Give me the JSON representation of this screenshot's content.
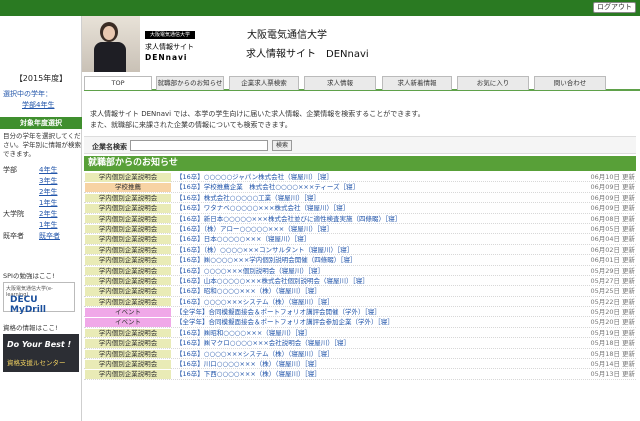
{
  "header": {
    "logout_label": "ログアウト",
    "logo_tag": "大阪電気通信大学",
    "logo_line1": "求人情報サイト",
    "logo_line2": "DENnavi",
    "site_title_line1": "大阪電気通信大学",
    "site_title_line2": "求人情報サイト　DENnavi"
  },
  "nav": {
    "tabs": [
      "TOP",
      "就職部からのお知らせ",
      "企業求人票検索",
      "求人情報",
      "求人新着情報",
      "お気に入り",
      "問い合わせ"
    ]
  },
  "sidebar": {
    "year": "【2015年度】",
    "gakunen_label": "選択中の学年：",
    "gakunen_value": "学部4年生",
    "select_head": "対象年度選択",
    "select_desc": "目分の学年を選択してください。学年別に情報が検索できます。",
    "grades": [
      {
        "cat": "学部",
        "label": "4年生"
      },
      {
        "cat": "",
        "label": "3年生"
      },
      {
        "cat": "",
        "label": "2年生"
      },
      {
        "cat": "",
        "label": "1年生"
      },
      {
        "cat": "大学院",
        "label": "2年生"
      },
      {
        "cat": "",
        "label": "1年生"
      },
      {
        "cat": "既卒者",
        "label": "既卒者"
      }
    ],
    "spi_label": "SPIの勉強はここ!",
    "spi_banner_small": "大阪電気通信大学(e-learning)",
    "spi_banner_big": "DECU MyDrill",
    "shikaku_label": "資格の情報はここ!",
    "shikaku_banner_line1": "Do Your Best !",
    "shikaku_banner_line2": "資格支援ルセンター"
  },
  "main": {
    "intro_line1": "求人情報サイト DENnavi では、本学の学生向けに届いた求人情報、企業情報を検索することができます。",
    "intro_line2": "また、就職部に来課された企業の情報についても検索できます。",
    "search_label": "企業名検索",
    "search_placeholder": "",
    "search_button": "検索",
    "notice_head": "就職部からのお知らせ"
  },
  "notices": [
    {
      "cat": "学内個別企業説明会",
      "type": "normal",
      "title": "【16卒】○○○○○ジャパン株式会社（寝屋川）［寝］",
      "date": "06月10日",
      "upd": "更新"
    },
    {
      "cat": "学校推薦",
      "type": "suisen",
      "title": "【16卒】学校推薦企業　株式会社○○○○×××ティーズ［寝］",
      "date": "06月09日",
      "upd": "更新"
    },
    {
      "cat": "学内個別企業説明会",
      "type": "normal",
      "title": "【16卒】株式会社○○○○○工業（寝屋川）［寝］",
      "date": "06月09日",
      "upd": "更新"
    },
    {
      "cat": "学内個別企業説明会",
      "type": "normal",
      "title": "【16卒】ワタナベ○○○○○×××株式会社（寝屋川）［寝］",
      "date": "06月09日",
      "upd": "更新"
    },
    {
      "cat": "学内個別企業説明会",
      "type": "normal",
      "title": "【16卒】新日本○○○○○×××株式会社並びに適性検査実施（四條畷）［寝］",
      "date": "06月08日",
      "upd": "更新"
    },
    {
      "cat": "学内個別企業説明会",
      "type": "normal",
      "title": "【16卒】（株）アロー○○○○○×××（寝屋川）［寝］",
      "date": "06月05日",
      "upd": "更新"
    },
    {
      "cat": "学内個別企業説明会",
      "type": "normal",
      "title": "【16卒】日本○○○○○×××（寝屋川）［寝］",
      "date": "06月04日",
      "upd": "更新"
    },
    {
      "cat": "学内個別企業説明会",
      "type": "normal",
      "title": "【16卒】（株）○○○○×××コンサルタント（寝屋川）［寝］",
      "date": "06月02日",
      "upd": "更新"
    },
    {
      "cat": "学内個別企業説明会",
      "type": "normal",
      "title": "【16卒】㈱○○○○×××学内個別説明会開催（四條畷）［寝］",
      "date": "06月01日",
      "upd": "更新"
    },
    {
      "cat": "学内個別企業説明会",
      "type": "normal",
      "title": "【16卒】○○○○×××個別説明会（寝屋川）［寝］",
      "date": "05月29日",
      "upd": "更新"
    },
    {
      "cat": "学内個別企業説明会",
      "type": "normal",
      "title": "【16卒】山本○○○○○×××株式会社個別説明会（寝屋川）［寝］",
      "date": "05月27日",
      "upd": "更新"
    },
    {
      "cat": "学内個別企業説明会",
      "type": "normal",
      "title": "【16卒】昭和○○○○×××（株）（寝屋川）［寝］",
      "date": "05月25日",
      "upd": "更新"
    },
    {
      "cat": "学内個別企業説明会",
      "type": "normal",
      "title": "【16卒】○○○○×××システム（株）（寝屋川）［寝］",
      "date": "05月22日",
      "upd": "更新"
    },
    {
      "cat": "イベント",
      "type": "event",
      "title": "【全学年】合同模擬面接会＆ポートフォリオ講評会開催（学外）［寝］",
      "date": "05月20日",
      "upd": "更新"
    },
    {
      "cat": "イベント",
      "type": "event",
      "title": "【全学年】合同模擬面接会＆ポートフォリオ講評会参加企業（学外）［寝］",
      "date": "05月20日",
      "upd": "更新"
    },
    {
      "cat": "学内個別企業説明会",
      "type": "normal",
      "title": "【16卒】㈱昭和○○○○×××（寝屋川）［寝］",
      "date": "05月19日",
      "upd": "更新"
    },
    {
      "cat": "学内個別企業説明会",
      "type": "normal",
      "title": "【16卒】㈱マクロ○○○○×××会社説明会（寝屋川）［寝］",
      "date": "05月18日",
      "upd": "更新"
    },
    {
      "cat": "学内個別企業説明会",
      "type": "normal",
      "title": "【16卒】○○○○×××システム（株）（寝屋川）［寝］",
      "date": "05月18日",
      "upd": "更新"
    },
    {
      "cat": "学内個別企業説明会",
      "type": "normal",
      "title": "【16卒】川口○○○○×××（株）（寝屋川）［寝］",
      "date": "05月14日",
      "upd": "更新"
    },
    {
      "cat": "学内個別企業説明会",
      "type": "normal",
      "title": "【16卒】下西○○○○×××（株）（寝屋川）［寝］",
      "date": "05月13日",
      "upd": "更新"
    }
  ]
}
